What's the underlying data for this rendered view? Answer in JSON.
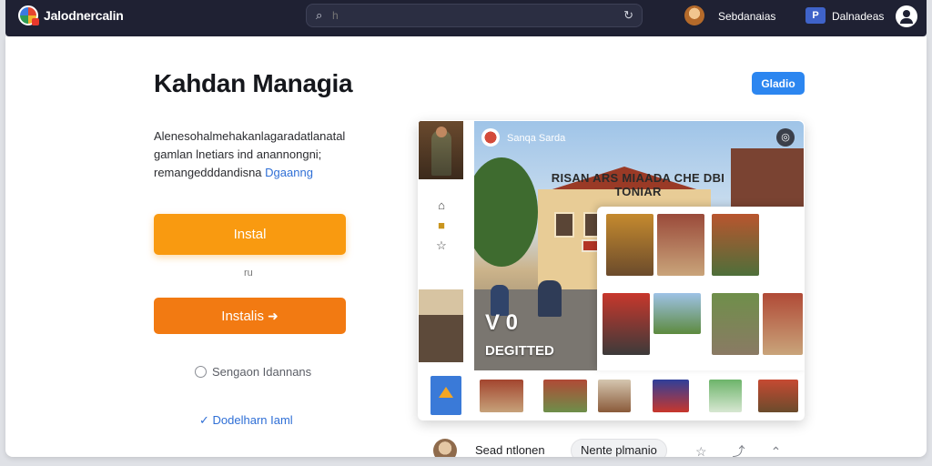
{
  "app": {
    "title": "Jalodnercalin"
  },
  "search": {
    "placeholder": "h"
  },
  "nav": {
    "link1": "Sebdanaias",
    "badge": "P",
    "link2": "Dalnadeas"
  },
  "page": {
    "title": "Kahdan Managia",
    "top_button": "Gladio",
    "description_lines": [
      "Alenesohalmehakanlagaradatlanatal",
      "gamlan lnetiars ind anannongni;",
      "remangedddandisna"
    ],
    "description_link": "Dgaanng",
    "install_primary": "Instal",
    "or_text": "ru",
    "install_secondary": "Instalis",
    "install_secondary_icon": "➜",
    "support_text": "Sengaon Idannans",
    "more_link": "Dodelharn Iaml"
  },
  "preview": {
    "hero_chip_label": "Sanqa Sarda",
    "hero_sign": "RISAN ARS MIAADA CHE DBI TONIAR",
    "hero_counter": "V 0",
    "hero_caption": "DEGITTED",
    "footer_label": "Sead ntlonen",
    "footer_pill": "Nente plmanio"
  },
  "icons": {
    "logo": "app-logo",
    "search": "search-icon",
    "reload": "reload-icon",
    "profile": "user-icon",
    "home": "home-icon",
    "bookmark": "bookmark-icon",
    "star": "star-icon"
  },
  "colors": {
    "topbar": "#1f2133",
    "primary_button": "#f99a10",
    "secondary_button": "#f27a12",
    "accent_blue": "#2c86f0",
    "link": "#2f6fd6"
  }
}
